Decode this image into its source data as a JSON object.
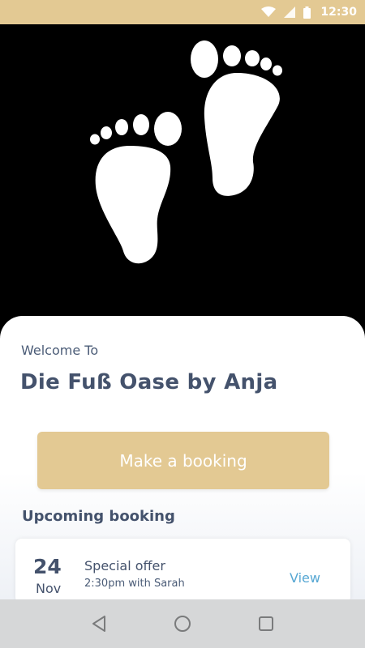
{
  "status_bar": {
    "time": "12:30",
    "icons": [
      "wifi-icon",
      "signal-icon",
      "battery-icon"
    ]
  },
  "hero": {
    "image": "feet-icon"
  },
  "welcome": {
    "label": "Welcome To",
    "business_name": "Die Fuß Oase by Anja"
  },
  "booking_button": {
    "label": "Make a booking"
  },
  "upcoming": {
    "title": "Upcoming booking",
    "booking": {
      "day": "24",
      "month": "Nov",
      "title": "Special offer",
      "subtitle": "2:30pm with Sarah",
      "action": "View"
    }
  },
  "nav_bar": {
    "buttons": [
      "back-icon",
      "home-icon",
      "recents-icon"
    ]
  },
  "colors": {
    "accent": "#e3c993",
    "text_dark": "#44526c",
    "link": "#56a7d3",
    "nav_bg": "#d6d7d8"
  }
}
